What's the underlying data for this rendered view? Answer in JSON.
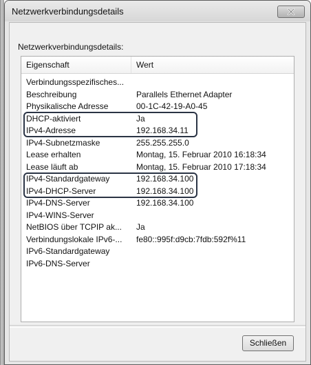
{
  "window": {
    "title": "Netzwerkverbindungsdetails",
    "close_icon": "close-icon"
  },
  "group_label": "Netzwerkverbindungsdetails:",
  "columns": [
    "Eigenschaft",
    "Wert"
  ],
  "rows": [
    {
      "property": "Verbindungsspezifisches...",
      "value": ""
    },
    {
      "property": "Beschreibung",
      "value": "Parallels Ethernet Adapter"
    },
    {
      "property": "Physikalische Adresse",
      "value": "00-1C-42-19-A0-45"
    },
    {
      "property": "DHCP-aktiviert",
      "value": "Ja"
    },
    {
      "property": "IPv4-Adresse",
      "value": "192.168.34.11"
    },
    {
      "property": "IPv4-Subnetzmaske",
      "value": "255.255.255.0"
    },
    {
      "property": "Lease erhalten",
      "value": "Montag, 15. Februar 2010 16:18:34"
    },
    {
      "property": "Lease läuft ab",
      "value": "Montag, 15. Februar 2010 17:18:34"
    },
    {
      "property": "IPv4-Standardgateway",
      "value": "192.168.34.100"
    },
    {
      "property": "IPv4-DHCP-Server",
      "value": "192.168.34.100"
    },
    {
      "property": "IPv4-DNS-Server",
      "value": "192.168.34.100"
    },
    {
      "property": "IPv4-WINS-Server",
      "value": ""
    },
    {
      "property": "NetBIOS über TCPIP ak...",
      "value": "Ja"
    },
    {
      "property": "Verbindungslokale IPv6-...",
      "value": "fe80::995f:d9cb:7fdb:592f%11"
    },
    {
      "property": "IPv6-Standardgateway",
      "value": ""
    },
    {
      "property": "IPv6-DNS-Server",
      "value": ""
    }
  ],
  "buttons": {
    "close_label": "Schließen"
  },
  "colors": {
    "highlight_border": "#2a3344",
    "window_bg": "#f0f0f0"
  }
}
